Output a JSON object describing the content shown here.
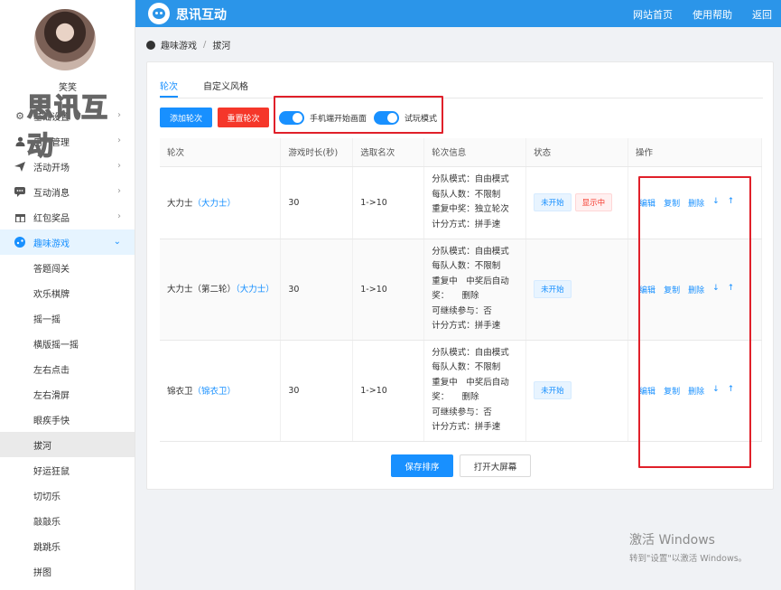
{
  "sidebar": {
    "username": "笑笑",
    "watermark": "思讯互动",
    "menu": [
      {
        "label": "基础设置",
        "icon": "gear-icon",
        "glyph": "⚙"
      },
      {
        "label": "用户管理",
        "icon": "user-icon",
        "glyph": "👤"
      },
      {
        "label": "活动开场",
        "icon": "send-icon",
        "glyph": "➤"
      },
      {
        "label": "互动消息",
        "icon": "message-icon",
        "glyph": "▬"
      },
      {
        "label": "红包奖品",
        "icon": "gift-icon",
        "glyph": "▣"
      },
      {
        "label": "趣味游戏",
        "icon": "game-icon",
        "glyph": "●"
      }
    ],
    "submenu": [
      "答题闯关",
      "欢乐棋牌",
      "摇一摇",
      "横版摇一摇",
      "左右点击",
      "左右滑屏",
      "眼疾手快",
      "拔河",
      "好运狂鼠",
      "切切乐",
      "敲敲乐",
      "跳跳乐",
      "拼图"
    ]
  },
  "topbar": {
    "brand": "思讯互动",
    "links": [
      "网站首页",
      "使用帮助",
      "返回"
    ]
  },
  "breadcrumb": [
    "趣味游戏",
    "拔河"
  ],
  "tabs": [
    "轮次",
    "自定义风格"
  ],
  "toolbar": {
    "add_round": "添加轮次",
    "reset_round": "重置轮次",
    "toggle_mobile": "手机端开始画面",
    "toggle_trial": "试玩模式"
  },
  "table": {
    "headers": [
      "轮次",
      "游戏时长(秒)",
      "选取名次",
      "轮次信息",
      "状态",
      "操作"
    ],
    "rows": [
      {
        "name": "大力士",
        "name_link": "（大力士）",
        "duration": "30",
        "rank": "1->10",
        "info": [
          "分队模式：自由模式",
          "每队人数：不限制",
          "重复中奖：独立轮次",
          "计分方式：拼手速"
        ],
        "status": "未开始",
        "status2": "显示中"
      },
      {
        "name": "大力士（第二轮）",
        "name_link": "（大力士）",
        "duration": "30",
        "rank": "1->10",
        "info": [
          "分队模式：自由模式",
          "每队人数：不限制",
          "重复中　中奖后自动",
          "奖：　　删除",
          "可继续参与：否",
          "计分方式：拼手速"
        ],
        "status": "未开始",
        "status2": ""
      },
      {
        "name": "锦衣卫",
        "name_link": "（锦衣卫）",
        "duration": "30",
        "rank": "1->10",
        "info": [
          "分队模式：自由模式",
          "每队人数：不限制",
          "重复中　中奖后自动",
          "奖：　　删除",
          "可继续参与：否",
          "计分方式：拼手速"
        ],
        "status": "未开始",
        "status2": ""
      }
    ],
    "ops": [
      "编辑",
      "复制",
      "删除",
      "↓",
      "↑"
    ]
  },
  "footer_buttons": {
    "save_order": "保存排序",
    "open_screen": "打开大屏幕"
  },
  "windows_watermark": {
    "line1": "激活 Windows",
    "line2": "转到\"设置\"以激活 Windows。"
  },
  "colors": {
    "primary": "#1890ff",
    "topbar": "#2b95e9",
    "danger": "#f5372a",
    "annotation": "#e0202a"
  }
}
